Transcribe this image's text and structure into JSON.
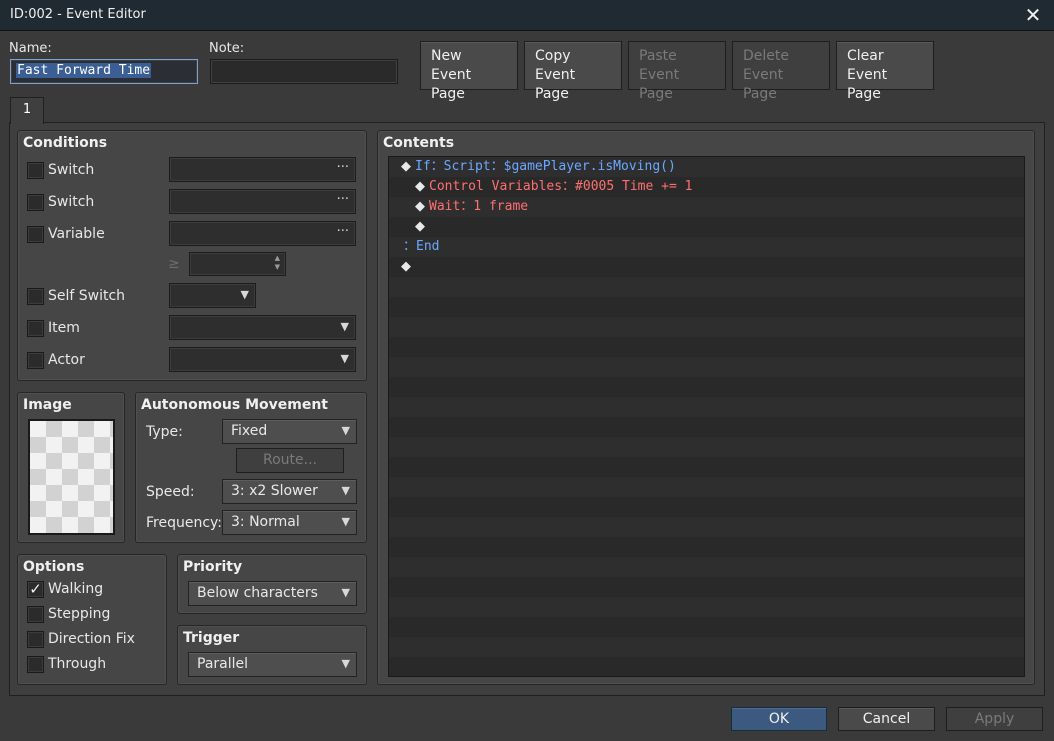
{
  "window": {
    "title": "ID:002 - Event Editor",
    "close_icon": "close-icon"
  },
  "header": {
    "name_label": "Name:",
    "name_value": "Fast Forward Time",
    "note_label": "Note:",
    "note_value": "",
    "buttons": [
      {
        "line1": "New",
        "line2": "Event Page",
        "enabled": true
      },
      {
        "line1": "Copy",
        "line2": "Event Page",
        "enabled": true
      },
      {
        "line1": "Paste",
        "line2": "Event Page",
        "enabled": false
      },
      {
        "line1": "Delete",
        "line2": "Event Page",
        "enabled": false
      },
      {
        "line1": "Clear",
        "line2": "Event Page",
        "enabled": true
      }
    ]
  },
  "tabs": [
    {
      "label": "1",
      "active": true
    }
  ],
  "conditions": {
    "title": "Conditions",
    "switch1_label": "Switch",
    "switch2_label": "Switch",
    "variable_label": "Variable",
    "gte_symbol": "≥",
    "self_switch_label": "Self Switch",
    "item_label": "Item",
    "actor_label": "Actor",
    "dots": "···"
  },
  "image": {
    "title": "Image"
  },
  "movement": {
    "title": "Autonomous Movement",
    "type_label": "Type:",
    "type_value": "Fixed",
    "route_label": "Route...",
    "speed_label": "Speed:",
    "speed_value": "3: x2 Slower",
    "frequency_label": "Frequency:",
    "frequency_value": "3: Normal"
  },
  "options": {
    "title": "Options",
    "items": [
      {
        "label": "Walking",
        "checked": true
      },
      {
        "label": "Stepping",
        "checked": false
      },
      {
        "label": "Direction Fix",
        "checked": false
      },
      {
        "label": "Through",
        "checked": false
      }
    ]
  },
  "priority": {
    "title": "Priority",
    "value": "Below characters"
  },
  "trigger": {
    "title": "Trigger",
    "value": "Parallel"
  },
  "contents": {
    "title": "Contents",
    "lines": [
      {
        "indent": 0,
        "diamond": true,
        "parts": [
          {
            "t": "If：Script：$gamePlayer.isMoving()",
            "c": "blue"
          }
        ]
      },
      {
        "indent": 1,
        "diamond": true,
        "parts": [
          {
            "t": "Control Variables：#0005 Time += 1",
            "c": "red"
          }
        ]
      },
      {
        "indent": 1,
        "diamond": true,
        "parts": [
          {
            "t": "Wait：1 frame",
            "c": "red"
          }
        ]
      },
      {
        "indent": 1,
        "diamond": true,
        "parts": []
      },
      {
        "indent": 0,
        "diamond": false,
        "parts": [
          {
            "t": "：End",
            "c": "blue"
          }
        ]
      },
      {
        "indent": 0,
        "diamond": true,
        "parts": []
      }
    ],
    "total_rows": 26
  },
  "footer": {
    "ok": "OK",
    "cancel": "Cancel",
    "apply": "Apply"
  },
  "colors": {
    "accent": "#3c5a80",
    "command_blue": "#6aa8ff",
    "command_red": "#ff7070"
  }
}
